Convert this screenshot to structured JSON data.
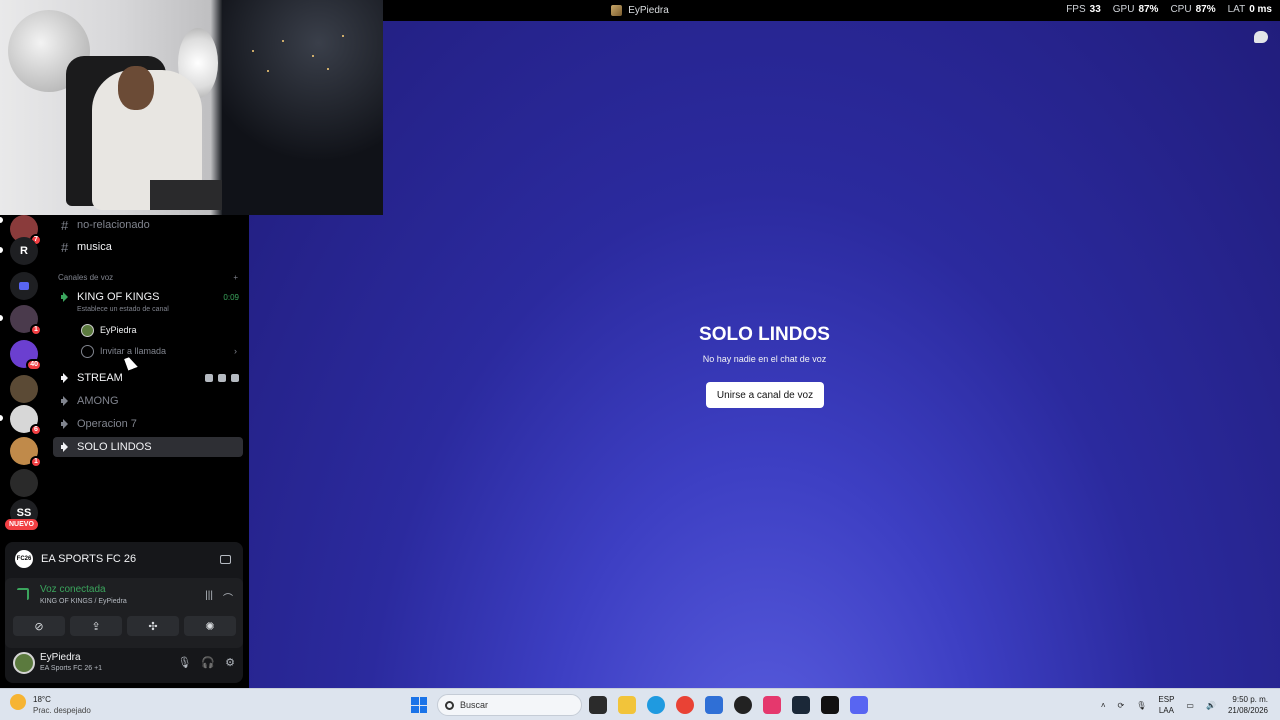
{
  "window": {
    "title": "EyPiedra"
  },
  "stats": {
    "fps_label": "FPS",
    "fps": "33",
    "gpu_label": "GPU",
    "gpu": "87%",
    "cpu_label": "CPU",
    "cpu": "87%",
    "lat_label": "LAT",
    "lat": "0 ms"
  },
  "servers": [
    {
      "label": "",
      "badge": "7"
    },
    {
      "label": "R",
      "badge": ""
    },
    {
      "label": "",
      "badge": ""
    },
    {
      "label": "",
      "badge": "1"
    },
    {
      "label": "",
      "badge": "40"
    },
    {
      "label": "",
      "badge": ""
    },
    {
      "label": "",
      "badge": "6"
    },
    {
      "label": "",
      "badge": "1"
    },
    {
      "label": "",
      "badge": ""
    },
    {
      "label": "SS",
      "badge": ""
    }
  ],
  "nuevo_label": "NUEVO",
  "channels": {
    "text": [
      {
        "name": "no-relacionado"
      },
      {
        "name": "musica"
      }
    ],
    "voice_header": "Canales de voz",
    "voice_main": {
      "name": "KING OF KINGS",
      "time": "0:09",
      "status": "Establece un estado de canal"
    },
    "member": {
      "name": "EyPiedra"
    },
    "invite": "Invitar a llamada",
    "voice": [
      {
        "name": "STREAM"
      },
      {
        "name": "AMONG"
      },
      {
        "name": "Operacion 7"
      },
      {
        "name": "SOLO LINDOS"
      }
    ]
  },
  "game": {
    "logo": "FC26",
    "name": "EA SPORTS FC 26"
  },
  "voice_status": {
    "title": "Voz conectada",
    "sub": "KING OF KINGS / EyPiedra"
  },
  "user": {
    "name": "EyPiedra",
    "status": "EA Sports FC 26 +1"
  },
  "stage": {
    "title": "SOLO LINDOS",
    "subtitle": "No hay nadie en el chat de voz",
    "join_label": "Unirse a canal de voz"
  },
  "taskbar": {
    "temp": "18°C",
    "weather": "Prac. despejado",
    "search_placeholder": "Buscar",
    "lang1": "ESP",
    "lang2": "LAA",
    "time": "9:50 p. m.",
    "date": "21/08/2026"
  },
  "colors": {
    "accent": "#5865f2",
    "voice_green": "#3ba55d",
    "badge_red": "#f23f43"
  }
}
